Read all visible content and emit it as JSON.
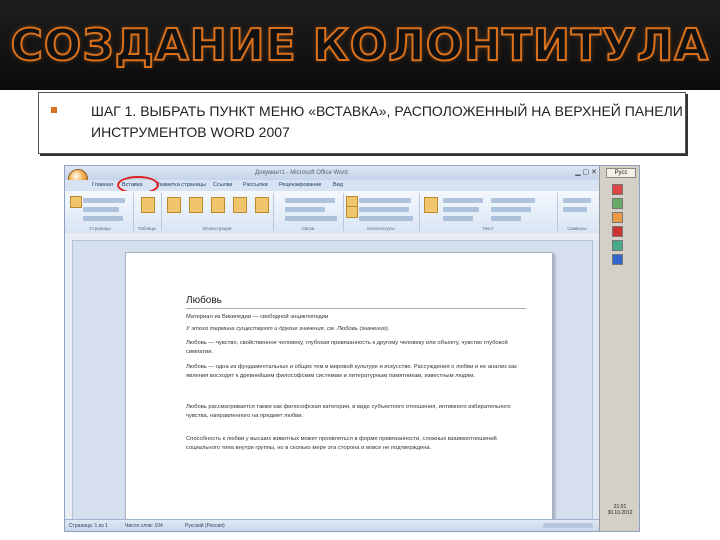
{
  "slide": {
    "title": "СОЗДАНИЕ КОЛОНТИТУЛА",
    "step_text": "ШАГ 1. ВЫБРАТЬ ПУНКТ МЕНЮ «ВСТАВКА», РАСПОЛОЖЕННЫЙ НА ВЕРХНЕЙ ПАНЕЛИ ИНСТРУМЕНТОВ WORD 2007",
    "accent_color": "#d8701c",
    "highlight_color": "#dd2222"
  },
  "word": {
    "window_title": "Документ1 - Microsoft Office Word",
    "tabs": [
      "Главная",
      "Вставка",
      "Разметка страницы",
      "Ссылки",
      "Рассылки",
      "Рецензирование",
      "Вид"
    ],
    "groups": [
      "Страницы",
      "Таблицы",
      "Иллюстрации",
      "Связи",
      "Колонтитулы",
      "Текст",
      "Символы"
    ],
    "status": {
      "page": "Страница: 1 из 1",
      "words": "Число слов: 104",
      "language": "Русский (Россия)"
    }
  },
  "document": {
    "title": "Любовь",
    "paragraphs": [
      "Материал из Википедии — свободной энциклопедии",
      "У этого термина существуют и другие значения, см. Любовь (значения).",
      "Любовь — чувство, свойственное человеку, глубокая привязанность к другому человеку или объекту, чувство глубокой симпатии.",
      "Любовь — одна из фундаментальных и общих тем в мировой культуре и искусстве. Рассуждения о любви и ее анализ как явления восходят к древнейшим философским системам и литературным памятникам, известным людям.",
      "Любовь рассматривается также как философская категория, в виде субъектного отношения, интимного избирательного чувства, направленного на предмет любви.",
      "Способность к любви у высших животных может проявляться в форме привязанности, сложных взаимоотношений социального типа внутри группы, но в сколько мере эта сторона и вовсе не подтверждена."
    ]
  },
  "taskbar": {
    "lang": "Русс",
    "time": "21:01",
    "date": "30.10.2012"
  }
}
